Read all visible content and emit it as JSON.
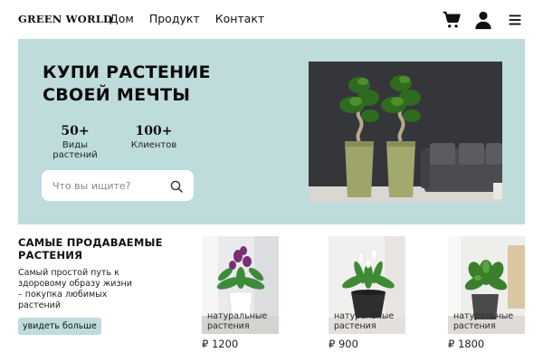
{
  "header": {
    "logo": "GREEN WORLD",
    "nav": [
      "Дом",
      "Продукт",
      "Контакт"
    ],
    "icons": [
      "cart-icon",
      "user-icon",
      "menu-icon"
    ]
  },
  "hero": {
    "title_line1": "КУПИ РАСТЕНИЕ",
    "title_line2": "СВОЕЙ МЕЧТЫ",
    "stats": [
      {
        "number": "50+",
        "label": "Виды растений"
      },
      {
        "number": "100+",
        "label": "Клиентов"
      }
    ],
    "search": {
      "placeholder": "Что вы ищите?",
      "value": ""
    },
    "background_color": "#bedcdb"
  },
  "best_sellers": {
    "title": "САМЫЕ ПРОДАВАЕМЫЕ РАСТЕНИЯ",
    "text": "Самый простой путь к здоровому образу жизни – покупка любимых растений",
    "button": "увидеть больше"
  },
  "products": [
    {
      "tag": "натуральные растения",
      "price": "₽ 1200"
    },
    {
      "tag": "натуральные растения",
      "price": "₽ 900"
    },
    {
      "tag": "натуральные растения",
      "price": "₽ 1800"
    }
  ],
  "colors": {
    "accent": "#bedcdb",
    "text": "#111111"
  }
}
